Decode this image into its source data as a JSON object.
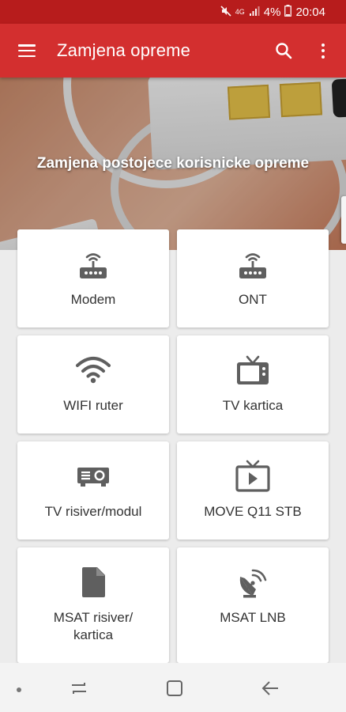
{
  "status_bar": {
    "network": "4G",
    "battery": "4%",
    "time": "20:04",
    "icons": [
      "mute-icon",
      "signal-icon",
      "battery-icon"
    ]
  },
  "app_bar": {
    "title": "Zamjena opreme",
    "menu_icon": "menu-icon",
    "search_icon": "search-icon",
    "more_icon": "more-vert-icon"
  },
  "hero": {
    "caption": "Zamjena postojece korisnicke opreme"
  },
  "items": [
    {
      "label": "Modem",
      "icon": "router-icon"
    },
    {
      "label": "ONT",
      "icon": "router-icon"
    },
    {
      "label": "WIFI ruter",
      "icon": "wifi-icon"
    },
    {
      "label": "TV kartica",
      "icon": "tv-icon"
    },
    {
      "label": "TV risiver/modul",
      "icon": "projector-icon"
    },
    {
      "label": "MOVE Q11 STB",
      "icon": "live-tv-icon"
    },
    {
      "label": "MSAT risiver/ kartica",
      "icon": "file-icon"
    },
    {
      "label": "MSAT LNB",
      "icon": "satellite-dish-icon"
    }
  ],
  "colors": {
    "primary": "#d32f2f",
    "primary_dark": "#b71c1c",
    "icon_gray": "#5f5f5f",
    "background": "#ececec"
  }
}
